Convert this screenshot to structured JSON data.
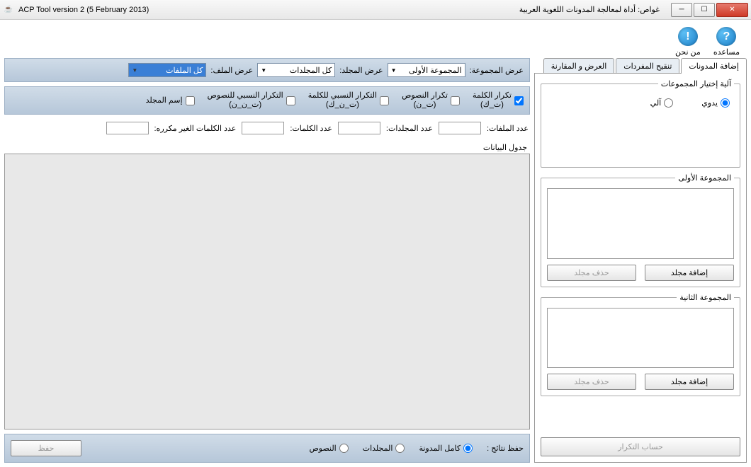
{
  "titlebar": {
    "app_title": "ACP Tool version 2 (5 February 2013)",
    "arabic_title": "غواص: أداة لمعالجة المدونات اللغوية العربية"
  },
  "help": {
    "help_label": "مساعده",
    "about_label": "من نحن"
  },
  "tabs": {
    "add_corpus": "إضافة المدونات",
    "refine_vocab": "تنقيح المفردات",
    "view_compare": "العرض و المقارنة"
  },
  "selection": {
    "legend": "آلية إختيار المجموعات",
    "manual": "يدوي",
    "auto": "آلي"
  },
  "group1": {
    "legend": "المجموعة الأولى",
    "add": "إضافة مجلد",
    "delete": "حذف مجلد"
  },
  "group2": {
    "legend": "المجموعة الثانية",
    "add": "إضافة مجلد",
    "delete": "حذف مجلد"
  },
  "calc_btn": "حساب التكرار",
  "filters": {
    "group_label": "عرض المجموعة:",
    "group_value": "المجموعة الأولى",
    "folder_label": "عرض المجلد:",
    "folder_value": "كل المجلدات",
    "file_label": "عرض الملف:",
    "file_value": "كل الملفات"
  },
  "checks": {
    "word_freq": "تكرار الكلمة\n(ت_ك)",
    "text_freq": "تكرار النصوص\n(ت_ن)",
    "rel_word_freq": "التكرار النسبي للكلمة\n(ت_ن_ك)",
    "rel_text_freq": "التكرار النسبي للنصوص\n(ت_ن_ن)",
    "folder_name": "إسم المجلد"
  },
  "stats": {
    "files": "عدد الملفات:",
    "folders": "عدد المجلدات:",
    "words": "عدد الكلمات:",
    "unique_words": "عدد الكلمات الغير مكرره:"
  },
  "data_label": "جدول البيانات",
  "bottom": {
    "save_results": "حفظ نتائج :",
    "full_corpus": "كامل المدونة",
    "folders": "المجلدات",
    "texts": "النصوص",
    "save": "حفظ"
  }
}
